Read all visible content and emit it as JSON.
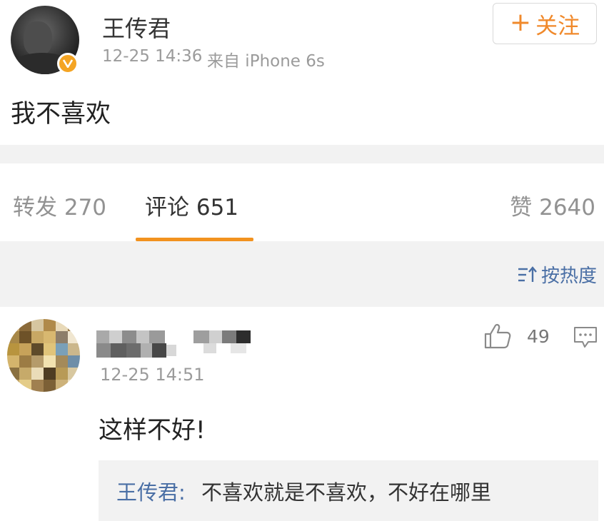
{
  "post": {
    "author": "王传君",
    "time": "12-25 14:36",
    "source": "来自 iPhone 6s",
    "follow_plus": "+",
    "follow_label": "关注",
    "text": "我不喜欢"
  },
  "tabs": {
    "repost": "转发 270",
    "comment": "评论 651",
    "like": "赞 2640",
    "active": "comment"
  },
  "sort": {
    "label": "按热度"
  },
  "comment": {
    "time": "12-25 14:51",
    "like_count": "49",
    "text": "这样不好!",
    "reply": {
      "author": "王传君",
      "separator": ":",
      "text": "不喜欢就是不喜欢，不好在哪里"
    }
  },
  "colors": {
    "accent_orange": "#f0892b",
    "tab_underline": "#f2921f",
    "link_blue": "#4a6fa5",
    "verified_badge": "#f4a423",
    "band_gray": "#f2f2f2"
  },
  "icons": {
    "verified": "verified-badge-icon",
    "sort": "sort-icon",
    "like": "thumbs-up-icon",
    "reply": "comment-bubble-icon"
  }
}
